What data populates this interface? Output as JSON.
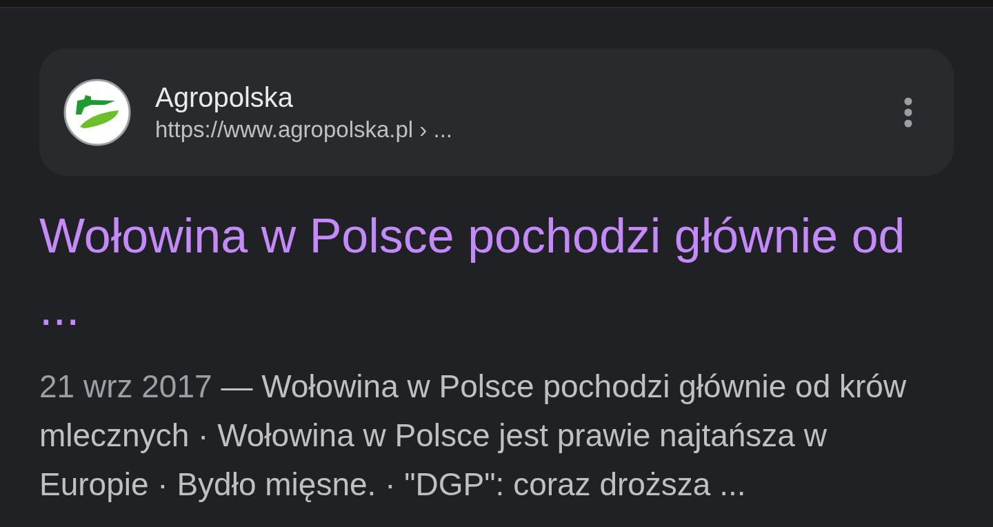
{
  "result": {
    "site_name": "Agropolska",
    "url": "https://www.agropolska.pl › ...",
    "title": "Wołowina w Polsce pochodzi głównie od ...",
    "date": "21 wrz 2017",
    "snippet": "— Wołowina w Polsce pochodzi głównie od krów mlecznych · Wołowina w Polsce jest prawie najtańsza w Europie · Bydło mięsne. · \"DGP\": coraz droższa ..."
  }
}
